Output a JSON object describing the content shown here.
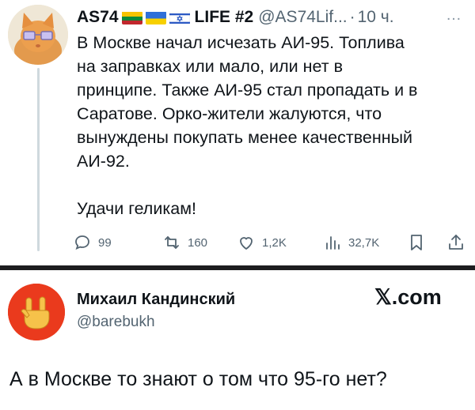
{
  "tweet1": {
    "author_name": "AS74",
    "author_suffix": "LIFE #2",
    "handle": "@AS74Lif...",
    "separator": "·",
    "time": "10 ч.",
    "more_icon": "…",
    "text": "В Москве начал исчезать АИ-95. Топлива\nна заправках или мало, или нет в\nпринципе. Также АИ-95 стал пропадать и в\nСаратове. Орко-жители жалуются, что\nвынуждены покупать менее качественный\nАИ-92.\n\nУдачи геликам!",
    "actions": {
      "replies": "99",
      "reposts": "160",
      "likes": "1,2K",
      "views": "32,7K"
    }
  },
  "tweet2": {
    "author_name": "Михаил Кандинский",
    "handle": "@barebukh",
    "brand": "𝕏.com",
    "text": "А в Москве то знают о том что 95-го нет?"
  },
  "colors": {
    "text": "#0f1419",
    "secondary": "#536471",
    "avatar2_bg": "#ea3a1d",
    "divider": "#1d1d1f"
  }
}
